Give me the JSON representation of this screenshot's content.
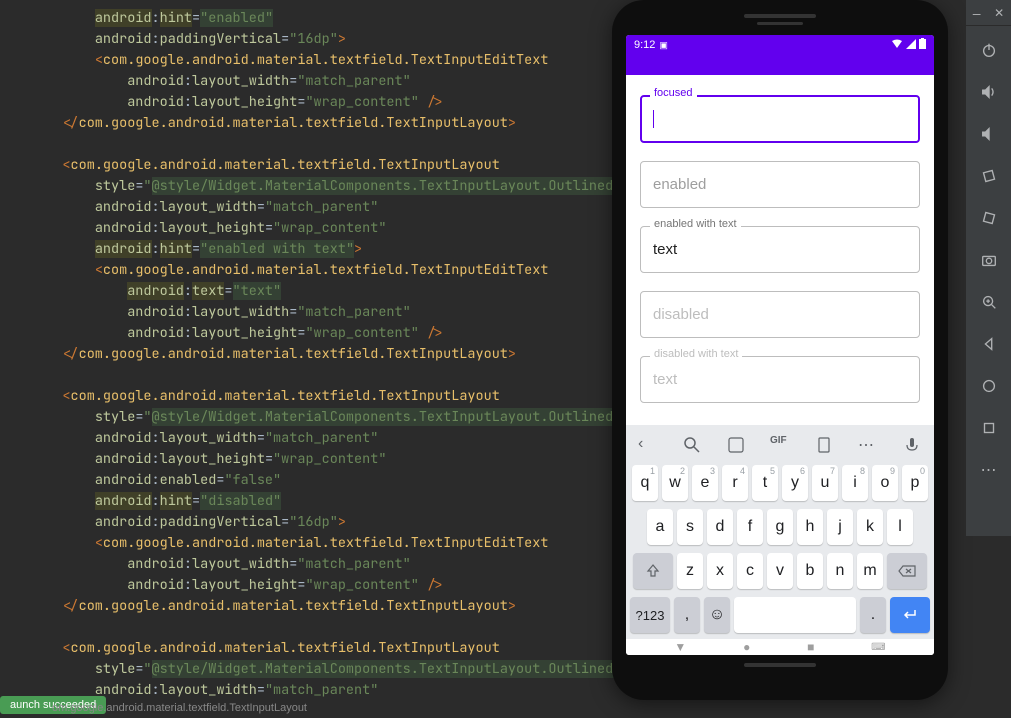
{
  "code": {
    "lines": [
      {
        "indent": 2,
        "type": "attr_hl",
        "attr": "android",
        "prop": "hint",
        "val": "enabled",
        "close": false
      },
      {
        "indent": 2,
        "type": "attr",
        "attr": "android",
        "prop": "paddingVertical",
        "val": "16dp",
        "close": ">"
      },
      {
        "indent": 2,
        "type": "open",
        "tag": "com.google.android.material.textfield.TextInputEditText"
      },
      {
        "indent": 3,
        "type": "attr",
        "attr": "android",
        "prop": "layout_width",
        "val": "match_parent"
      },
      {
        "indent": 3,
        "type": "attr",
        "attr": "android",
        "prop": "layout_height",
        "val": "wrap_content",
        "close": " />"
      },
      {
        "indent": 1,
        "type": "close",
        "tag": "com.google.android.material.textfield.TextInputLayout"
      },
      {
        "indent": 0,
        "type": "blank"
      },
      {
        "indent": 1,
        "type": "open",
        "tag": "com.google.android.material.textfield.TextInputLayout"
      },
      {
        "indent": 2,
        "type": "attr_hl2",
        "attr": "style",
        "val": "@style/Widget.MaterialComponents.TextInputLayout.OutlinedBox"
      },
      {
        "indent": 2,
        "type": "attr",
        "attr": "android",
        "prop": "layout_width",
        "val": "match_parent"
      },
      {
        "indent": 2,
        "type": "attr",
        "attr": "android",
        "prop": "layout_height",
        "val": "wrap_content"
      },
      {
        "indent": 2,
        "type": "attr_hl",
        "attr": "android",
        "prop": "hint",
        "val": "enabled with text",
        "close": ">"
      },
      {
        "indent": 2,
        "type": "open",
        "tag": "com.google.android.material.textfield.TextInputEditText"
      },
      {
        "indent": 3,
        "type": "attr_hl",
        "attr": "android",
        "prop": "text",
        "val": "text"
      },
      {
        "indent": 3,
        "type": "attr",
        "attr": "android",
        "prop": "layout_width",
        "val": "match_parent"
      },
      {
        "indent": 3,
        "type": "attr",
        "attr": "android",
        "prop": "layout_height",
        "val": "wrap_content",
        "close": " />"
      },
      {
        "indent": 1,
        "type": "close",
        "tag": "com.google.android.material.textfield.TextInputLayout"
      },
      {
        "indent": 0,
        "type": "blank"
      },
      {
        "indent": 1,
        "type": "open",
        "tag": "com.google.android.material.textfield.TextInputLayout"
      },
      {
        "indent": 2,
        "type": "attr_hl2",
        "attr": "style",
        "val": "@style/Widget.MaterialComponents.TextInputLayout.OutlinedBox"
      },
      {
        "indent": 2,
        "type": "attr",
        "attr": "android",
        "prop": "layout_width",
        "val": "match_parent"
      },
      {
        "indent": 2,
        "type": "attr",
        "attr": "android",
        "prop": "layout_height",
        "val": "wrap_content"
      },
      {
        "indent": 2,
        "type": "attr",
        "attr": "android",
        "prop": "enabled",
        "val": "false"
      },
      {
        "indent": 2,
        "type": "attr_hl",
        "attr": "android",
        "prop": "hint",
        "val": "disabled"
      },
      {
        "indent": 2,
        "type": "attr",
        "attr": "android",
        "prop": "paddingVertical",
        "val": "16dp",
        "close": ">"
      },
      {
        "indent": 2,
        "type": "open",
        "tag": "com.google.android.material.textfield.TextInputEditText"
      },
      {
        "indent": 3,
        "type": "attr",
        "attr": "android",
        "prop": "layout_width",
        "val": "match_parent"
      },
      {
        "indent": 3,
        "type": "attr",
        "attr": "android",
        "prop": "layout_height",
        "val": "wrap_content",
        "close": " />"
      },
      {
        "indent": 1,
        "type": "close",
        "tag": "com.google.android.material.textfield.TextInputLayout"
      },
      {
        "indent": 0,
        "type": "blank"
      },
      {
        "indent": 1,
        "type": "open",
        "tag": "com.google.android.material.textfield.TextInputLayout"
      },
      {
        "indent": 2,
        "type": "attr_hl2",
        "attr": "style",
        "val": "@style/Widget.MaterialComponents.TextInputLayout.OutlinedBox"
      },
      {
        "indent": 2,
        "type": "attr",
        "attr": "android",
        "prop": "layout_width",
        "val": "match_parent"
      }
    ]
  },
  "emulator": {
    "time": "9:12",
    "fields": {
      "focused_label": "focused",
      "enabled_hint": "enabled",
      "enabled_text_label": "enabled with text",
      "enabled_text_value": "text",
      "disabled_hint": "disabled",
      "disabled_text_label": "disabled with text",
      "disabled_text_value": "text"
    },
    "keyboard": {
      "row1": [
        "q",
        "w",
        "e",
        "r",
        "t",
        "y",
        "u",
        "i",
        "o",
        "p"
      ],
      "hints1": [
        "1",
        "2",
        "3",
        "4",
        "5",
        "6",
        "7",
        "8",
        "9",
        "0"
      ],
      "row2": [
        "a",
        "s",
        "d",
        "f",
        "g",
        "h",
        "j",
        "k",
        "l"
      ],
      "row3": [
        "z",
        "x",
        "c",
        "v",
        "b",
        "n",
        "m"
      ],
      "sym": "?123",
      "comma": ",",
      "period": "."
    }
  },
  "toast": "aunch succeeded",
  "breadcrumb": "om.google.android.material.textfield.TextInputLayout"
}
